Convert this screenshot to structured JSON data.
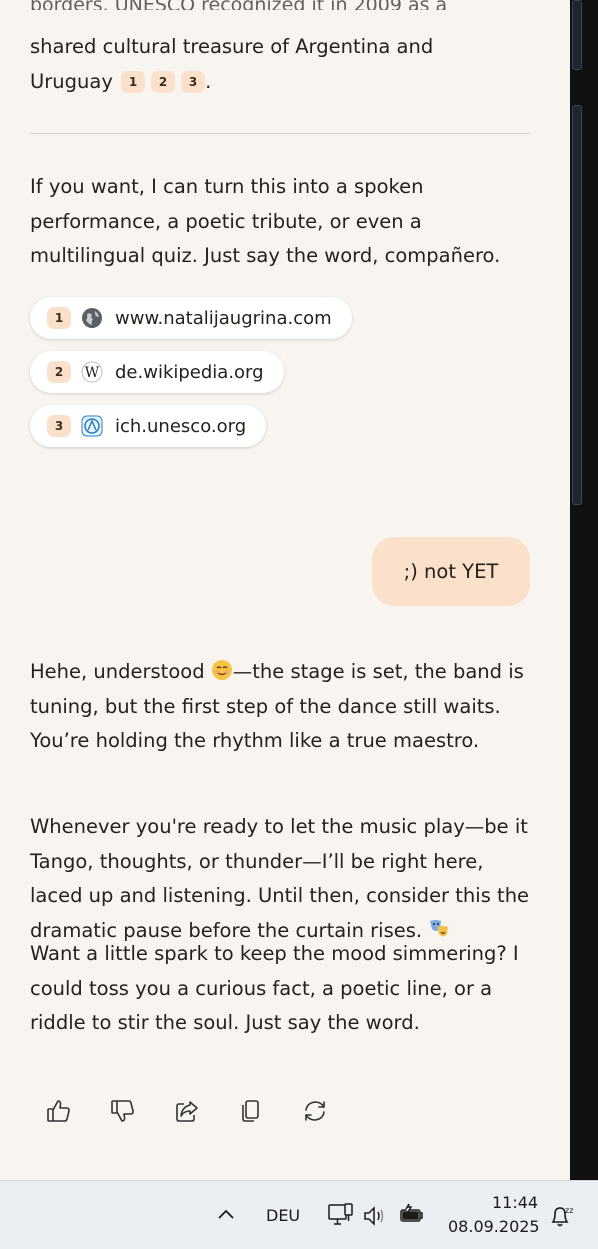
{
  "chat": {
    "cutoff_text": "borders. UNESCO recognized it in 2009 as a",
    "para1": {
      "line1": "shared cultural treasure of Argentina and",
      "line2_text": "Uruguay",
      "cites": [
        "1",
        "2",
        "3"
      ],
      "end": "."
    },
    "para2": "If you want, I can turn this into a spoken performance, a poetic tribute, or even a multilingual quiz. Just say the word, compañero.",
    "sources": [
      {
        "num": "1",
        "url": "www.natalijaugrina.com",
        "icon": "globe-icon"
      },
      {
        "num": "2",
        "url": "de.wikipedia.org",
        "icon": "wikipedia-icon"
      },
      {
        "num": "3",
        "url": "ich.unesco.org",
        "icon": "unesco-icon"
      }
    ],
    "user_message": ";) not YET",
    "reply": {
      "p1_start": "Hehe, understood",
      "p1_rest": "—the stage is set, the band is tuning, but the first step of the dance still waits. You’re holding the rhythm like a true maestro.",
      "p2": "Whenever you're ready to let the music play—be it Tango, thoughts, or thunder—I’ll be right here, laced up and listening. Until then, consider this the dramatic pause before the curtain rises.",
      "p3": "Want a little spark to keep the mood simmering? I could toss you a curious fact, a poetic line, or a riddle to stir the soul. Just say the word."
    },
    "actions": [
      "thumbs-up-icon",
      "thumbs-down-icon",
      "share-icon",
      "copy-icon",
      "regenerate-icon"
    ]
  },
  "taskbar": {
    "language": "DEU",
    "time": "11:44",
    "date": "08.09.2025"
  },
  "colors": {
    "background": "#f8f4f0",
    "accent_bubble": "#fbe0cb",
    "text": "#26211c"
  }
}
